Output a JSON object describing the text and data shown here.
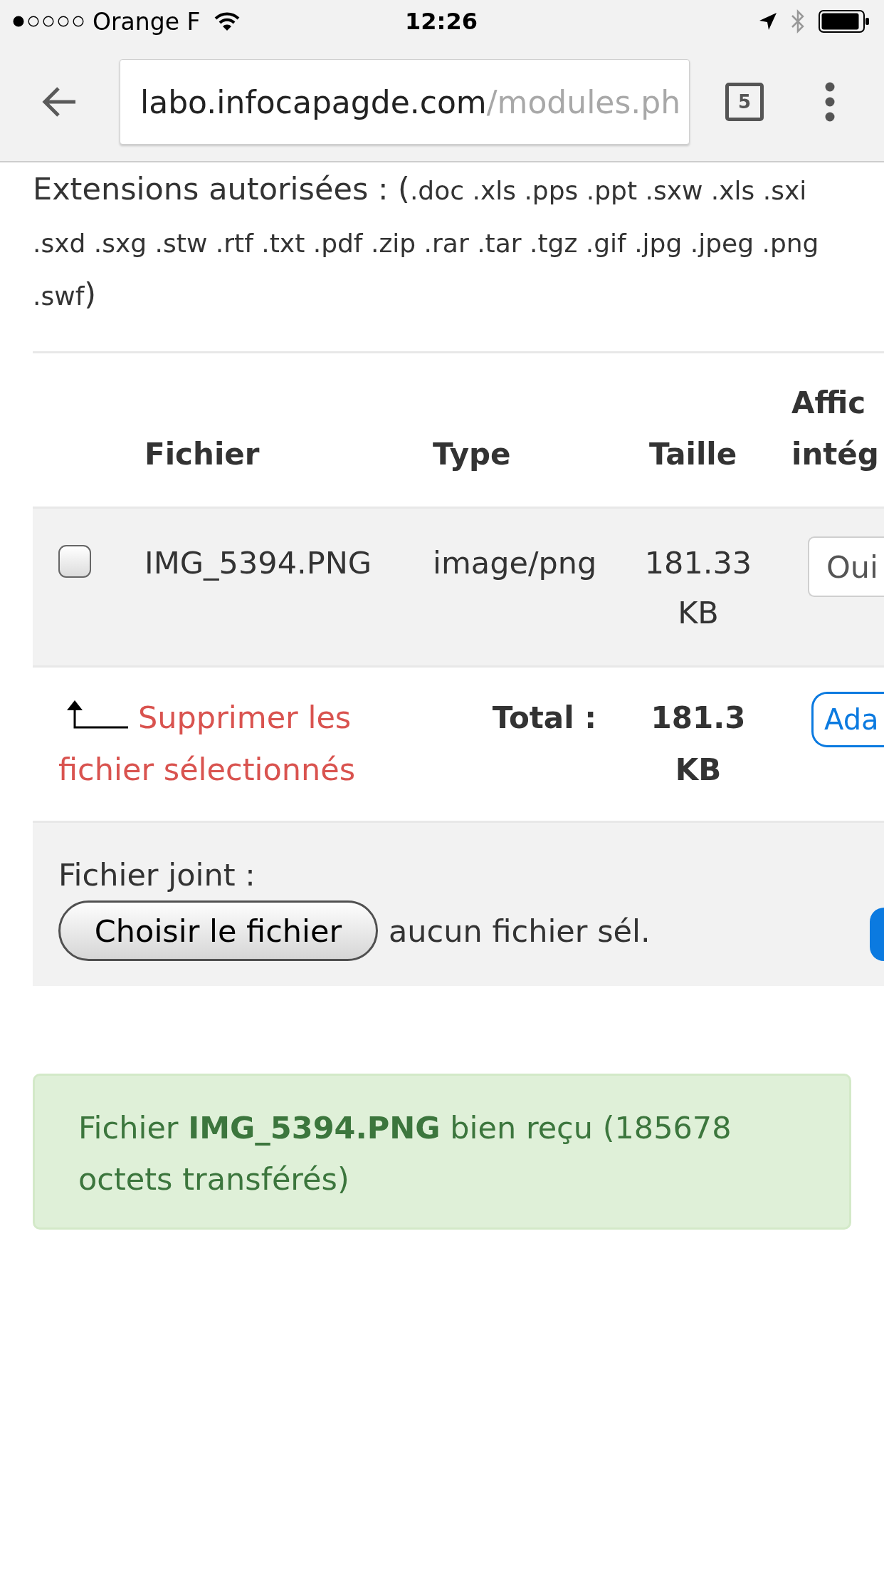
{
  "status_bar": {
    "carrier": "Orange F",
    "time": "12:26"
  },
  "browser": {
    "url_host": "labo.infocapagde.com",
    "url_path": "/modules.ph",
    "tab_count": "5"
  },
  "extensions": {
    "label": "Extensions autorisées : (",
    "list": ".doc .xls .pps .ppt .sxw .xls .sxi .sxd .sxg .stw .rtf .txt .pdf .zip .rar .tar .tgz .gif .jpg .jpeg .png .swf",
    "closing": ")"
  },
  "table": {
    "columns": [
      "Fichier",
      "Type",
      "Taille",
      "Affic intég"
    ],
    "rows": [
      {
        "checked": false,
        "file": "IMG_5394.PNG",
        "type": "image/png",
        "size": "181.33 KB",
        "display": "Oui"
      }
    ],
    "footer": {
      "delete_link": "Supprimer les fichier sélectionnés",
      "total_label": "Total :",
      "total_value": "181.3 KB",
      "action": "Ada"
    }
  },
  "upload": {
    "label": "Fichier joint :",
    "button": "Choisir le fichier",
    "status": "aucun fichier sél."
  },
  "alert": {
    "message": "Fichier **IMG_5394.PNG** bien reçu (185678 octets transférés)"
  }
}
